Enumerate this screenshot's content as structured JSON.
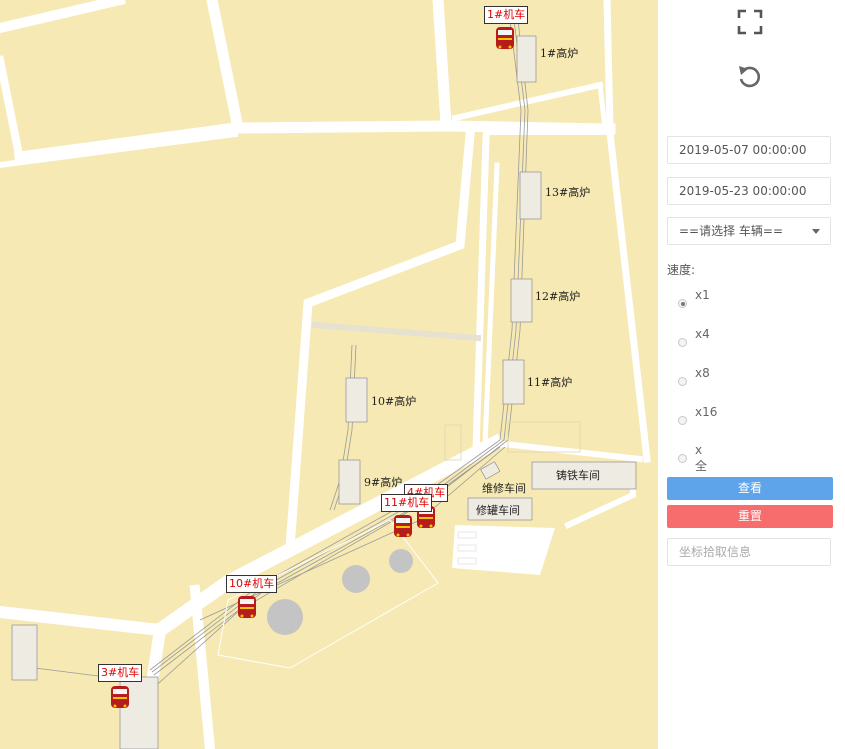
{
  "map": {
    "furnaces": [
      "1#高炉",
      "13#高炉",
      "12#高炉",
      "11#高炉",
      "10#高炉",
      "9#高炉"
    ],
    "buildings": [
      "铸铁车间",
      "维修车间",
      "修罐车间"
    ],
    "locomotives": [
      "1#机车",
      "4#机车",
      "11#机车",
      "10#机车",
      "3#机车"
    ]
  },
  "panel": {
    "fullscreen_icon": "fullscreen-icon",
    "reset_icon": "reset-icon",
    "start_time": "2019-05-07 00:00:00",
    "end_time": "2019-05-23 00:00:00",
    "vehicle_select": "==请选择 车辆==",
    "speed_label": "速度:",
    "speed_options": [
      "x1",
      "x4",
      "x8",
      "x16",
      "x全速"
    ],
    "selected_speed": "x1",
    "view_button": "查看",
    "reset_button": "重置",
    "coord_placeholder": "坐标拾取信息"
  },
  "colors": {
    "map_background": "#f6e9b3",
    "road": "#ffffff",
    "view_button": "#5ea4ea",
    "reset_button": "#f76d6d",
    "locomotive_label": "#e00000"
  }
}
